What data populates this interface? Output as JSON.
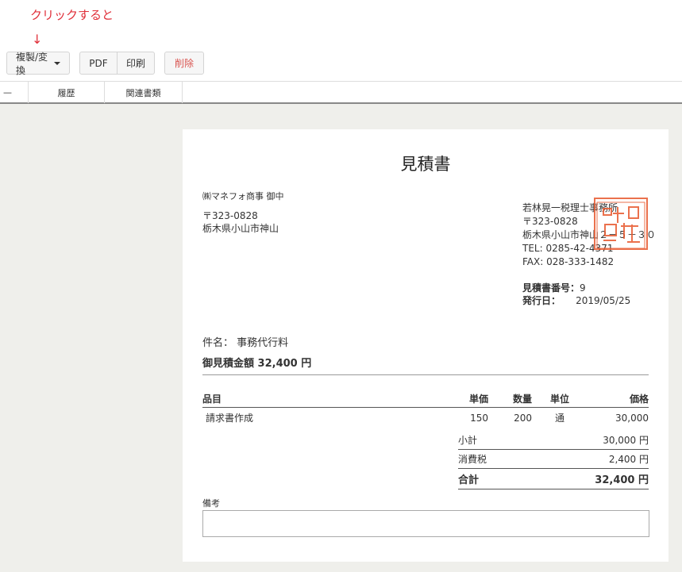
{
  "annotation": {
    "text": "クリックすると",
    "arrow": "↓"
  },
  "toolbar": {
    "duplicate_label": "複製/変換",
    "pdf_label": "PDF",
    "print_label": "印刷",
    "delete_label": "削除"
  },
  "tabs": {
    "first": "—",
    "history": "履歴",
    "related": "関連書類"
  },
  "document": {
    "title": "見積書",
    "client_name": "㈱マネフォ商事 御中",
    "client_zip": "〒323-0828",
    "client_address": "栃木県小山市神山",
    "issuer_name": "若林晃一税理士事務所",
    "issuer_zip": "〒323-0828",
    "issuer_address": "栃木県小山市神山２－５－３０",
    "issuer_tel": "TEL: 0285-42-4371",
    "issuer_fax": "FAX: 028-333-1482",
    "seal_text": "税理士晃一若林之印",
    "quote_no_label": "見積書番号：",
    "quote_no": "9",
    "issue_date_label": "発行日：",
    "issue_date": "2019/05/25",
    "subject_label": "件名：",
    "subject": "事務代行料",
    "total_label": "御見積金額",
    "total_value": "32,400 円",
    "columns": {
      "item": "品目",
      "unit_price": "単価",
      "qty": "数量",
      "unit": "単位",
      "price": "価格"
    },
    "rows": [
      {
        "item": "請求書作成",
        "unit_price": "150",
        "qty": "200",
        "unit": "通",
        "price": "30,000"
      }
    ],
    "subtotal_label": "小計",
    "subtotal": "30,000 円",
    "tax_label": "消費税",
    "tax": "2,400 円",
    "grand_label": "合計",
    "grand": "32,400 円",
    "remarks_label": "備考",
    "remarks": ""
  }
}
